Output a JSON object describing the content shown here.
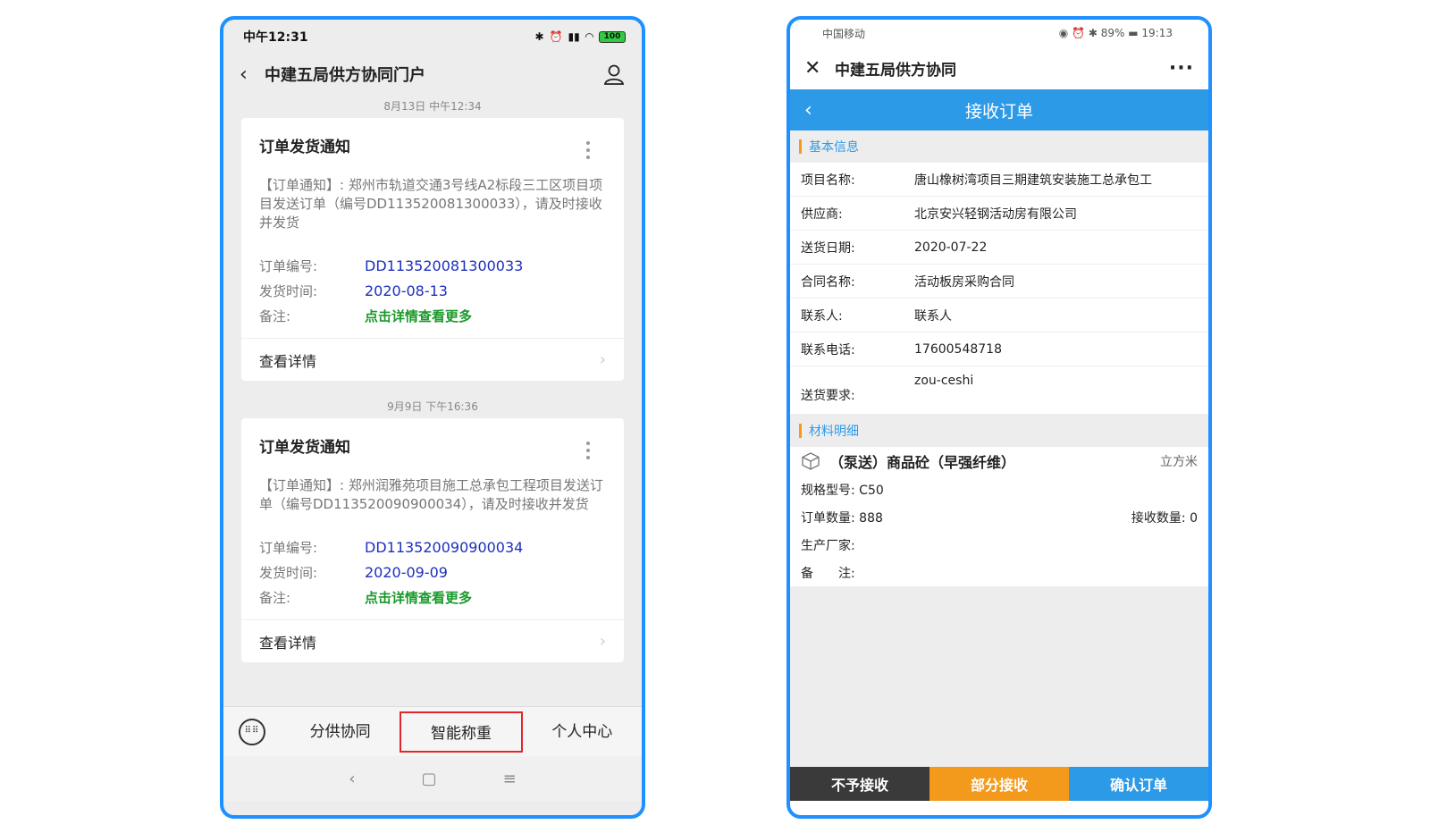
{
  "left": {
    "status": {
      "time": "中午12:31",
      "battery": "100"
    },
    "nav": {
      "title": "中建五局供方协同门户"
    },
    "messages": [
      {
        "timestamp": "8月13日 中午12:34",
        "title": "订单发货通知",
        "desc": "【订单通知】: 郑州市轨道交通3号线A2标段三工区项目项目发送订单（编号DD113520081300033），请及时接收并发货",
        "order_no_label": "订单编号:",
        "order_no": "DD113520081300033",
        "ship_time_label": "发货时间:",
        "ship_time": "2020-08-13",
        "remark_label": "备注:",
        "remark": "点击详情查看更多",
        "detail_label": "查看详情"
      },
      {
        "timestamp": "9月9日 下午16:36",
        "title": "订单发货通知",
        "desc": "【订单通知】: 郑州润雅苑项目施工总承包工程项目发送订单（编号DD113520090900034），请及时接收并发货",
        "order_no_label": "订单编号:",
        "order_no": "DD113520090900034",
        "ship_time_label": "发货时间:",
        "ship_time": "2020-09-09",
        "remark_label": "备注:",
        "remark": "点击详情查看更多",
        "detail_label": "查看详情"
      }
    ],
    "bottom_menu": [
      "分供协同",
      "智能称重",
      "个人中心"
    ],
    "sysnav": {
      "back": "‹",
      "home": "▢",
      "menu": "≡"
    }
  },
  "right": {
    "status": {
      "carrier": "中国移动",
      "battery": "89%",
      "time": "19:13"
    },
    "nav": {
      "title": "中建五局供方协同"
    },
    "header": {
      "title": "接收订单"
    },
    "basic_section": "基本信息",
    "basic": [
      {
        "k": "项目名称:",
        "v": "唐山橡树湾项目三期建筑安装施工总承包工"
      },
      {
        "k": "供应商:",
        "v": "北京安兴轻钢活动房有限公司"
      },
      {
        "k": "送货日期:",
        "v": "2020-07-22"
      },
      {
        "k": "合同名称:",
        "v": "活动板房采购合同"
      },
      {
        "k": "联系人:",
        "v": "联系人"
      },
      {
        "k": "联系电话:",
        "v": "17600548718"
      },
      {
        "k": "送货要求:",
        "v": "zou-ceshi"
      }
    ],
    "material_section": "材料明细",
    "material": {
      "name": "（泵送）商品砼（早强纤维）",
      "unit": "立方米",
      "spec_label": "规格型号:",
      "spec": "C50",
      "order_qty_label": "订单数量:",
      "order_qty": "888",
      "recv_qty_label": "接收数量:",
      "recv_qty": "0",
      "maker_label": "生产厂家:",
      "remark_label": "备　　注:"
    },
    "actions": [
      {
        "label": "不予接收",
        "color": "#3a3a3a"
      },
      {
        "label": "部分接收",
        "color": "#f39a1c"
      },
      {
        "label": "确认订单",
        "color": "#2d9ae8"
      }
    ]
  }
}
